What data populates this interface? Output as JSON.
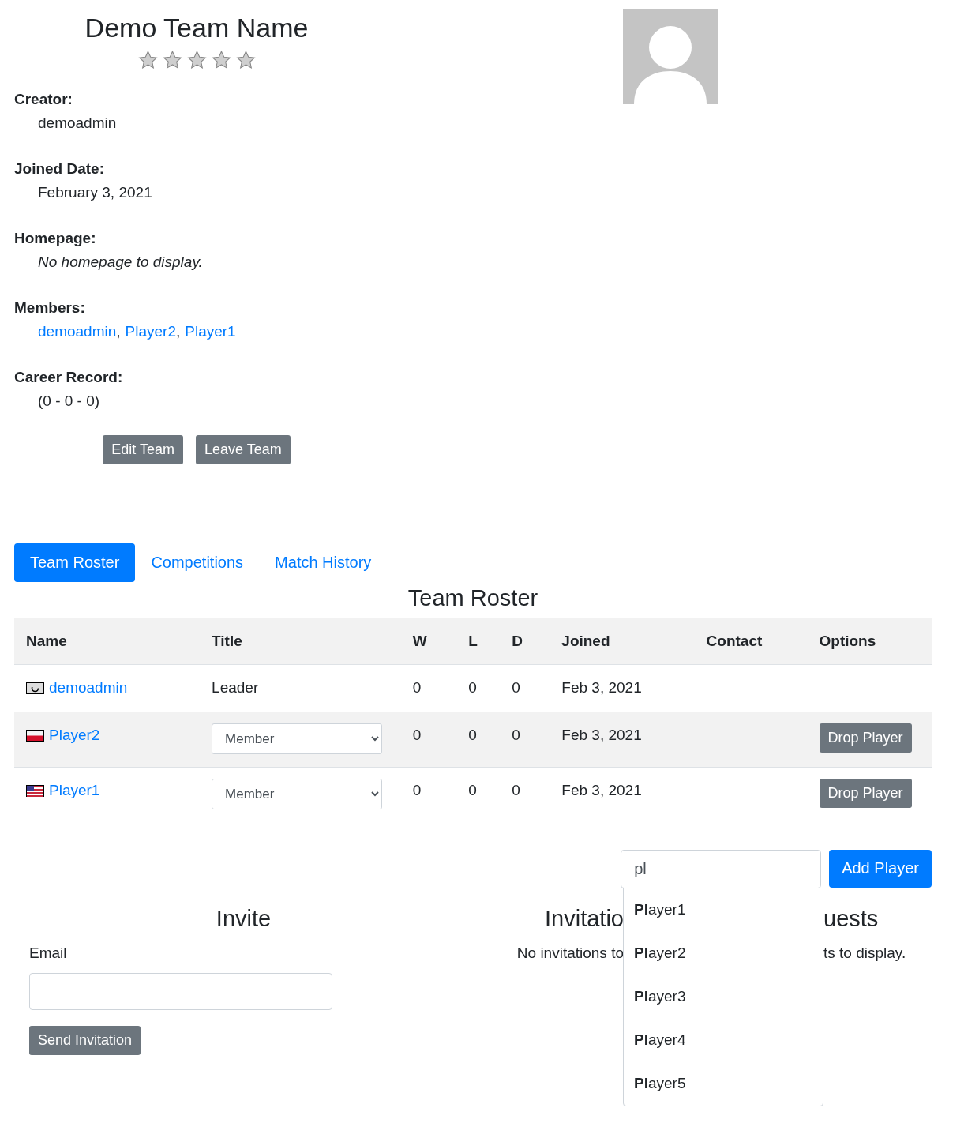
{
  "team": {
    "name": "Demo Team Name",
    "stars": 0
  },
  "details": [
    {
      "label": "Creator:",
      "kind": "text",
      "value": "demoadmin"
    },
    {
      "label": "Joined Date:",
      "kind": "text",
      "value": "February 3, 2021"
    },
    {
      "label": "Homepage:",
      "kind": "note",
      "value": "No homepage to display."
    },
    {
      "label": "Members:",
      "kind": "links",
      "links": [
        "demoadmin",
        "Player2",
        "Player1"
      ],
      "separator": ","
    },
    {
      "label": "Career Record:",
      "kind": "text",
      "value": "(0 - 0 - 0)"
    }
  ],
  "team_buttons": [
    "Edit Team",
    "Leave Team"
  ],
  "tabs": [
    {
      "label": "Team Roster",
      "selected": true
    },
    {
      "label": "Competitions",
      "selected": false
    },
    {
      "label": "Match History",
      "selected": false
    }
  ],
  "roster": {
    "title": "Team Roster",
    "columns": [
      "Name",
      "Title",
      "W",
      "L",
      "D",
      "Joined",
      "Contact",
      "Options"
    ],
    "rows": [
      {
        "flag": {
          "kind": "unknown"
        },
        "name": "demoadmin",
        "title": {
          "kind": "text",
          "text": "Leader"
        },
        "w": "0",
        "l": "0",
        "d": "0",
        "joined": "Feb 3, 2021"
      },
      {
        "flag": {
          "kind": "poland"
        },
        "name": "Player2",
        "title": {
          "kind": "select",
          "text": "Member"
        },
        "w": "0",
        "l": "0",
        "d": "0",
        "joined": "Feb 3, 2021",
        "option": "Drop Player"
      },
      {
        "flag": {
          "kind": "usa"
        },
        "name": "Player1",
        "title": {
          "kind": "select",
          "text": "Member"
        },
        "w": "0",
        "l": "0",
        "d": "0",
        "joined": "Feb 3, 2021",
        "option": "Drop Player"
      }
    ]
  },
  "add_player": {
    "value": "pl",
    "button": "Add Player",
    "suggestions": [
      "**Pl**ayer1",
      "**Pl**ayer2",
      "**Pl**ayer3",
      "**Pl**ayer4",
      "**Pl**ayer5"
    ]
  },
  "invite": {
    "title": "Invite",
    "email_label": "Email",
    "button": "Send Invitation"
  },
  "invitations": {
    "title": "Invitatio",
    "message": "No invitations to"
  },
  "requests": {
    "title": "uests",
    "message": "ts to display."
  }
}
